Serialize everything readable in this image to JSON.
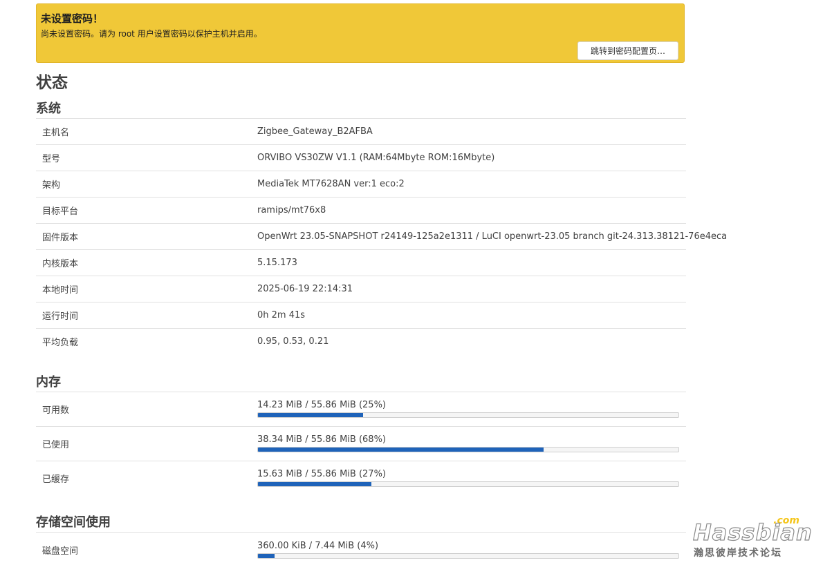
{
  "alert": {
    "title": "未设置密码！",
    "text": "尚未设置密码。请为 root 用户设置密码以保护主机并启用。",
    "button": "跳转到密码配置页…"
  },
  "page_title": "状态",
  "system": {
    "heading": "系统",
    "rows": [
      {
        "label": "主机名",
        "value": "Zigbee_Gateway_B2AFBA"
      },
      {
        "label": "型号",
        "value": "ORVIBO VS30ZW V1.1 (RAM:64Mbyte ROM:16Mbyte)"
      },
      {
        "label": "架构",
        "value": "MediaTek MT7628AN ver:1 eco:2"
      },
      {
        "label": "目标平台",
        "value": "ramips/mt76x8"
      },
      {
        "label": "固件版本",
        "value": "OpenWrt 23.05-SNAPSHOT r24149-125a2e1311 / LuCI openwrt-23.05 branch git-24.313.38121-76e4eca"
      },
      {
        "label": "内核版本",
        "value": "5.15.173"
      },
      {
        "label": "本地时间",
        "value": "2025-06-19 22:14:31"
      },
      {
        "label": "运行时间",
        "value": "0h 2m 41s"
      },
      {
        "label": "平均负载",
        "value": "0.95, 0.53, 0.21"
      }
    ]
  },
  "memory": {
    "heading": "内存",
    "rows": [
      {
        "label": "可用数",
        "text": "14.23 MiB / 55.86 MiB (25%)",
        "percent": 25
      },
      {
        "label": "已使用",
        "text": "38.34 MiB / 55.86 MiB (68%)",
        "percent": 68
      },
      {
        "label": "已缓存",
        "text": "15.63 MiB / 55.86 MiB (27%)",
        "percent": 27
      }
    ]
  },
  "storage": {
    "heading": "存储空间使用",
    "rows": [
      {
        "label": "磁盘空间",
        "text": "360.00 KiB / 7.44 MiB (4%)",
        "percent": 4
      }
    ]
  },
  "watermark": {
    "main": "Hassbian",
    "com": ".com",
    "sub": "瀚思彼岸技术论坛"
  },
  "colors": {
    "alert_bg": "#f0c838",
    "progress_fill": "#1f63b9"
  }
}
